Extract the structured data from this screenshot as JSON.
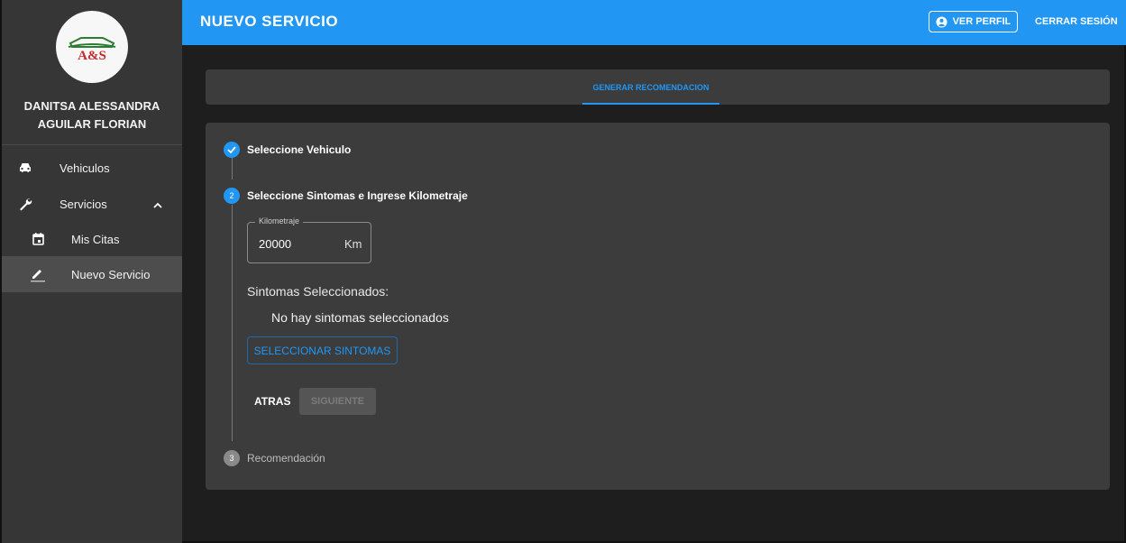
{
  "sidebar": {
    "logo_text": "A&S",
    "user_name_line1": "DANITSA ALESSANDRA",
    "user_name_line2": "AGUILAR FLORIAN",
    "items": [
      {
        "label": "Vehiculos",
        "icon": "car-icon"
      },
      {
        "label": "Servicios",
        "icon": "wrench-icon",
        "expanded": true
      },
      {
        "label": "Mis Citas",
        "icon": "calendar-icon"
      },
      {
        "label": "Nuevo Servicio",
        "icon": "pencil-icon",
        "active": true
      }
    ]
  },
  "header": {
    "title": "NUEVO SERVICIO",
    "profile_button": "VER PERFIL",
    "logout_button": "CERRAR SESIÓN"
  },
  "tabs": [
    {
      "label": "GENERAR RECOMENDACION",
      "active": true
    }
  ],
  "stepper": {
    "steps": [
      {
        "title": "Seleccione Vehiculo",
        "state": "completed"
      },
      {
        "title": "Seleccione Sintomas e Ingrese Kilometraje",
        "number": "2",
        "state": "active"
      },
      {
        "title": "Recomendación",
        "number": "3",
        "state": "pending"
      }
    ],
    "mileage": {
      "label": "Kilometraje",
      "value": "20000",
      "suffix": "Km"
    },
    "symptoms_label": "Sintomas Seleccionados:",
    "symptoms_empty": "No hay sintomas seleccionados",
    "select_button": "SELECCIONAR SINTOMAS",
    "back_button": "ATRAS",
    "next_button": "SIGUIENTE"
  },
  "colors": {
    "primary": "#2196f3",
    "sidebar_bg": "#363636",
    "card_bg": "#3c3c3c",
    "page_bg": "#1e1e1e",
    "logo_red": "#c62828",
    "logo_green": "#2e7d32"
  }
}
